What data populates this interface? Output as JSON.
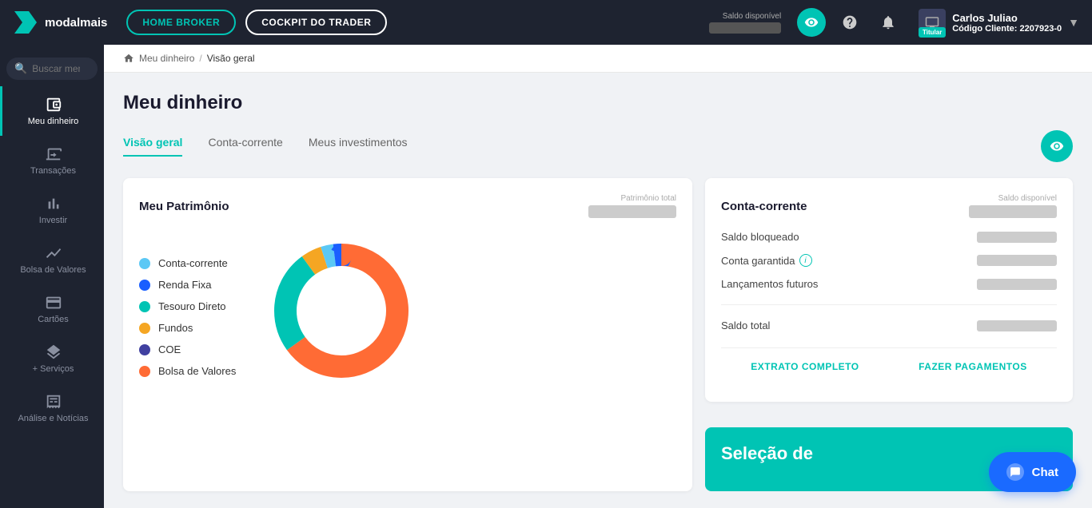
{
  "topnav": {
    "logo_text": "modalmais",
    "btn_home_broker": "HOME BROKER",
    "btn_cockpit": "COCKPIT DO TRADER",
    "saldo_label": "Saldo disponível",
    "user_name": "Carlos Juliao",
    "user_code_label": "Código Cliente:",
    "user_code": "2207923-0",
    "titular_badge": "Titular"
  },
  "sidebar": {
    "search_placeholder": "Buscar menu",
    "items": [
      {
        "id": "meu-dinheiro",
        "label": "Meu dinheiro",
        "active": true
      },
      {
        "id": "transacoes",
        "label": "Transações",
        "active": false
      },
      {
        "id": "investir",
        "label": "Investir",
        "active": false
      },
      {
        "id": "bolsa-valores",
        "label": "Bolsa de Valores",
        "active": false
      },
      {
        "id": "cartoes",
        "label": "Cartões",
        "active": false
      },
      {
        "id": "mais-servicos",
        "label": "+ Serviços",
        "active": false
      },
      {
        "id": "analise",
        "label": "Análise e Notícias",
        "active": false
      }
    ]
  },
  "breadcrumb": {
    "home": "Meu dinheiro",
    "sep": "/",
    "current": "Visão geral"
  },
  "page": {
    "title": "Meu dinheiro"
  },
  "tabs": [
    {
      "id": "visao-geral",
      "label": "Visão geral",
      "active": true
    },
    {
      "id": "conta-corrente",
      "label": "Conta-corrente",
      "active": false
    },
    {
      "id": "meus-investimentos",
      "label": "Meus investimentos",
      "active": false
    }
  ],
  "patrimony_card": {
    "title": "Meu Patrimônio",
    "total_label": "Patrimônio total",
    "legend": [
      {
        "id": "conta-corrente-leg",
        "label": "Conta-corrente",
        "color": "#5bc8f5"
      },
      {
        "id": "renda-fixa-leg",
        "label": "Renda Fixa",
        "color": "#1a5fff"
      },
      {
        "id": "tesouro-direto-leg",
        "label": "Tesouro Direto",
        "color": "#00c4b4"
      },
      {
        "id": "fundos-leg",
        "label": "Fundos",
        "color": "#f5a623"
      },
      {
        "id": "coe-leg",
        "label": "COE",
        "color": "#4040a0"
      },
      {
        "id": "bolsa-valores-leg",
        "label": "Bolsa de Valores",
        "color": "#ff6b35"
      }
    ],
    "donut": {
      "segments": [
        {
          "color": "#ff6b35",
          "percentage": 65
        },
        {
          "color": "#00c4b4",
          "percentage": 25
        },
        {
          "color": "#f5a623",
          "percentage": 5
        },
        {
          "color": "#5bc8f5",
          "percentage": 3
        },
        {
          "color": "#1a5fff",
          "percentage": 2
        }
      ]
    }
  },
  "conta_card": {
    "title": "Conta-corrente",
    "saldo_disponivel_label": "Saldo disponível",
    "rows": [
      {
        "id": "saldo-bloqueado",
        "label": "Saldo bloqueado"
      },
      {
        "id": "conta-garantida",
        "label": "Conta garantida",
        "has_info": true
      },
      {
        "id": "lancamentos-futuros",
        "label": "Lançamentos futuros"
      },
      {
        "id": "saldo-total",
        "label": "Saldo total"
      }
    ],
    "actions": [
      {
        "id": "extrato-completo",
        "label": "EXTRATO COMPLETO"
      },
      {
        "id": "fazer-pagamentos",
        "label": "FAZER PAGAMENTOS"
      }
    ]
  },
  "selecao_card": {
    "title": "Seleção de"
  },
  "chat": {
    "label": "Chat"
  }
}
